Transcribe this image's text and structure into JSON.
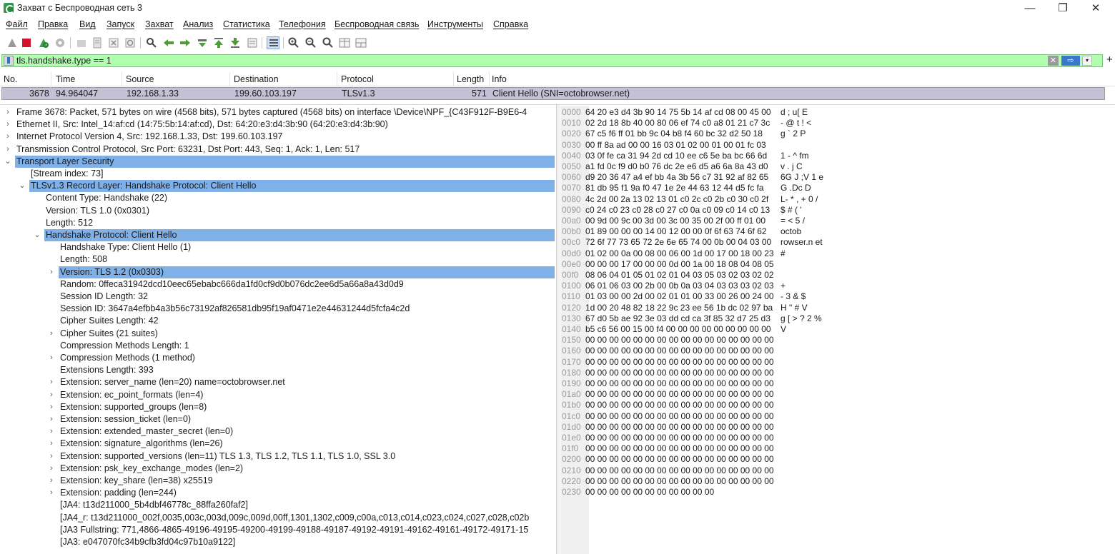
{
  "window": {
    "title": "Захват с Беспроводная сеть 3",
    "minimize": "—",
    "maximize": "❐",
    "close": "✕"
  },
  "menu": [
    "Файл",
    "Правка",
    "Вид",
    "Запуск",
    "Захват",
    "Анализ",
    "Статистика",
    "Телефония",
    "Беспроводная связь",
    "Инструменты",
    "Справка"
  ],
  "toolbar": [
    "shark-fin-start-icon",
    "stop-capture-icon",
    "restart-capture-icon",
    "capture-options-icon",
    "open-file-icon",
    "save-file-icon",
    "close-file-icon",
    "reload-file-icon",
    "find-packet-icon",
    "go-back-icon",
    "go-forward-icon",
    "go-to-packet-icon",
    "go-first-icon",
    "go-last-icon",
    "autoscroll-icon",
    "colorize-icon",
    "zoom-in-icon",
    "zoom-out-icon",
    "zoom-reset-icon",
    "resize-columns-icon",
    "layout-icon"
  ],
  "filter": {
    "value": "tls.handshake.type == 1",
    "clear": "✕",
    "apply": "⇨",
    "dropdown": "▾",
    "add": "+"
  },
  "packet_list": {
    "headers": [
      "No.",
      "Time",
      "Source",
      "Destination",
      "Protocol",
      "Length",
      "Info"
    ],
    "rows": [
      {
        "no": "3678",
        "time": "94.964047",
        "source": "192.168.1.33",
        "destination": "199.60.103.197",
        "protocol": "TLSv1.3",
        "length": "571",
        "info": "Client Hello (SNI=octobrowser.net)"
      }
    ]
  },
  "tree": [
    {
      "text": "Frame 3678: Packet, 571 bytes on wire (4568 bits), 571 bytes captured (4568 bits) on interface \\Device\\NPF_{C43F912F-B9E6-4",
      "level": 0,
      "exp": "›"
    },
    {
      "text": "Ethernet II, Src: Intel_14:af:cd (14:75:5b:14:af:cd), Dst: 64:20:e3:d4:3b:90 (64:20:e3:d4:3b:90)",
      "level": 0,
      "exp": "›"
    },
    {
      "text": "Internet Protocol Version 4, Src: 192.168.1.33, Dst: 199.60.103.197",
      "level": 0,
      "exp": "›"
    },
    {
      "text": "Transmission Control Protocol, Src Port: 63231, Dst Port: 443, Seq: 1, Ack: 1, Len: 517",
      "level": 0,
      "exp": "›"
    },
    {
      "text": "Transport Layer Security",
      "level": 0,
      "exp": "⌄",
      "sel": true
    },
    {
      "text": "[Stream index: 73]",
      "level": 1,
      "exp": ""
    },
    {
      "text": "TLSv1.3 Record Layer: Handshake Protocol: Client Hello",
      "level": 1,
      "exp": "⌄",
      "sel": true
    },
    {
      "text": "Content Type: Handshake (22)",
      "level": 2,
      "exp": ""
    },
    {
      "text": "Version: TLS 1.0 (0x0301)",
      "level": 2,
      "exp": ""
    },
    {
      "text": "Length: 512",
      "level": 2,
      "exp": ""
    },
    {
      "text": "Handshake Protocol: Client Hello",
      "level": 2,
      "exp": "⌄",
      "sel": true
    },
    {
      "text": "Handshake Type: Client Hello (1)",
      "level": 3,
      "exp": ""
    },
    {
      "text": "Length: 508",
      "level": 3,
      "exp": ""
    },
    {
      "text": "Version: TLS 1.2 (0x0303)",
      "level": 3,
      "exp": "›",
      "sel": true
    },
    {
      "text": "Random: 0ffeca31942dcd10eec65ebabc666da1fd0cf9d0b076dc2ee6d5a66a8a43d0d9",
      "level": 3,
      "exp": ""
    },
    {
      "text": "Session ID Length: 32",
      "level": 3,
      "exp": ""
    },
    {
      "text": "Session ID: 3647a4efbb4a3b56c73192af826581db95f19af0471e2e44631244d5fcfa4c2d",
      "level": 3,
      "exp": ""
    },
    {
      "text": "Cipher Suites Length: 42",
      "level": 3,
      "exp": ""
    },
    {
      "text": "Cipher Suites (21 suites)",
      "level": 3,
      "exp": "›"
    },
    {
      "text": "Compression Methods Length: 1",
      "level": 3,
      "exp": ""
    },
    {
      "text": "Compression Methods (1 method)",
      "level": 3,
      "exp": "›"
    },
    {
      "text": "Extensions Length: 393",
      "level": 3,
      "exp": ""
    },
    {
      "text": "Extension: server_name (len=20) name=octobrowser.net",
      "level": 3,
      "exp": "›"
    },
    {
      "text": "Extension: ec_point_formats (len=4)",
      "level": 3,
      "exp": "›"
    },
    {
      "text": "Extension: supported_groups (len=8)",
      "level": 3,
      "exp": "›"
    },
    {
      "text": "Extension: session_ticket (len=0)",
      "level": 3,
      "exp": "›"
    },
    {
      "text": "Extension: extended_master_secret (len=0)",
      "level": 3,
      "exp": "›"
    },
    {
      "text": "Extension: signature_algorithms (len=26)",
      "level": 3,
      "exp": "›"
    },
    {
      "text": "Extension: supported_versions (len=11) TLS 1.3, TLS 1.2, TLS 1.1, TLS 1.0, SSL 3.0",
      "level": 3,
      "exp": "›"
    },
    {
      "text": "Extension: psk_key_exchange_modes (len=2)",
      "level": 3,
      "exp": "›"
    },
    {
      "text": "Extension: key_share (len=38) x25519",
      "level": 3,
      "exp": "›"
    },
    {
      "text": "Extension: padding (len=244)",
      "level": 3,
      "exp": "›"
    },
    {
      "text": "[JA4: t13d211000_5b4dbf46778c_88ffa260faf2]",
      "level": 3,
      "exp": ""
    },
    {
      "text": "[JA4_r: t13d211000_002f,0035,003c,003d,009c,009d,00ff,1301,1302,c009,c00a,c013,c014,c023,c024,c027,c028,c02b",
      "level": 3,
      "exp": ""
    },
    {
      "text": "[JA3 Fullstring: 771,4866-4865-49196-49195-49200-49199-49188-49187-49192-49191-49162-49161-49172-49171-15",
      "level": 3,
      "exp": ""
    },
    {
      "text": "[JA3: e047070fc34b9cfb3fd04c97b10a9122]",
      "level": 3,
      "exp": ""
    }
  ],
  "hex": [
    {
      "off": "0000",
      "bytes": "64 20 e3 d4 3b 90 14 75  5b 14 af cd 08 00 45 00",
      "ascii": "d  ;  u[     E"
    },
    {
      "off": "0010",
      "bytes": "02 2d 18 8b 40 00 80 06  ef 74 c0 a8 01 21 c7 3c",
      "ascii": " -  @    t   !  <"
    },
    {
      "off": "0020",
      "bytes": "67 c5 f6 ff 01 bb 9c 04  b8 f4 60 bc 32 d2 50 18",
      "ascii": "g          ` 2 P"
    },
    {
      "off": "0030",
      "bytes": "00 ff 8a ad 00 00 16 03  01 02 00 01 00 01 fc 03",
      "ascii": ""
    },
    {
      "off": "0040",
      "bytes": "03 0f fe ca 31 94 2d cd  10 ee c6 5e ba bc 66 6d",
      "ascii": "    1 -    ^  fm"
    },
    {
      "off": "0050",
      "bytes": "a1 fd 0c f9 d0 b0 76 dc  2e e6 d5 a6 6a 8a 43 d0",
      "ascii": "      v .   j C"
    },
    {
      "off": "0060",
      "bytes": "d9 20 36 47 a4 ef bb 4a  3b 56 c7 31 92 af 82 65",
      "ascii": "  6G   J ;V 1   e"
    },
    {
      "off": "0070",
      "bytes": "81 db 95 f1 9a f0 47 1e  2e 44 63 12 44 d5 fc fa",
      "ascii": "      G  .Dc D"
    },
    {
      "off": "0080",
      "bytes": "4c 2d 00 2a 13 02 13 01  c0 2c c0 2b c0 30 c0 2f",
      "ascii": "L- *     , + 0 /"
    },
    {
      "off": "0090",
      "bytes": "c0 24 c0 23 c0 28 c0 27  c0 0a c0 09 c0 14 c0 13",
      "ascii": " $ # ( '"
    },
    {
      "off": "00a0",
      "bytes": "00 9d 00 9c 00 3d 00 3c  00 35 00 2f 00 ff 01 00",
      "ascii": "     = <  5 /"
    },
    {
      "off": "00b0",
      "bytes": "01 89 00 00 00 14 00 12  00 00 0f 6f 63 74 6f 62",
      "ascii": "           octob"
    },
    {
      "off": "00c0",
      "bytes": "72 6f 77 73 65 72 2e 6e  65 74 00 0b 00 04 03 00",
      "ascii": "rowser.n et"
    },
    {
      "off": "00d0",
      "bytes": "01 02 00 0a 00 08 00 06  00 1d 00 17 00 18 00 23",
      "ascii": "               #"
    },
    {
      "off": "00e0",
      "bytes": "00 00 00 17 00 00 00 0d  00 1a 00 18 08 04 08 05",
      "ascii": ""
    },
    {
      "off": "00f0",
      "bytes": "08 06 04 01 05 01 02 01  04 03 05 03 02 03 02 02",
      "ascii": ""
    },
    {
      "off": "0100",
      "bytes": "06 01 06 03 00 2b 00 0b  0a 03 04 03 03 03 02 03",
      "ascii": "     +"
    },
    {
      "off": "0110",
      "bytes": "01 03 00 00 2d 00 02 01  01 00 33 00 26 00 24 00",
      "ascii": "    -     3 & $"
    },
    {
      "off": "0120",
      "bytes": "1d 00 20 48 82 18 22 9c  23 ee 56 1b dc 02 97 ba",
      "ascii": "   H  \"  # V"
    },
    {
      "off": "0130",
      "bytes": "67 d0 5b ae 92 3e 03 dd  cd ca 3f 85 32 d7 25 d3",
      "ascii": "g [  >    ? 2 %"
    },
    {
      "off": "0140",
      "bytes": "b5 c6 56 00 15 00 f4 00  00 00 00 00 00 00 00 00",
      "ascii": "  V"
    },
    {
      "off": "0150",
      "bytes": "00 00 00 00 00 00 00 00  00 00 00 00 00 00 00 00",
      "ascii": ""
    },
    {
      "off": "0160",
      "bytes": "00 00 00 00 00 00 00 00  00 00 00 00 00 00 00 00",
      "ascii": ""
    },
    {
      "off": "0170",
      "bytes": "00 00 00 00 00 00 00 00  00 00 00 00 00 00 00 00",
      "ascii": ""
    },
    {
      "off": "0180",
      "bytes": "00 00 00 00 00 00 00 00  00 00 00 00 00 00 00 00",
      "ascii": ""
    },
    {
      "off": "0190",
      "bytes": "00 00 00 00 00 00 00 00  00 00 00 00 00 00 00 00",
      "ascii": ""
    },
    {
      "off": "01a0",
      "bytes": "00 00 00 00 00 00 00 00  00 00 00 00 00 00 00 00",
      "ascii": ""
    },
    {
      "off": "01b0",
      "bytes": "00 00 00 00 00 00 00 00  00 00 00 00 00 00 00 00",
      "ascii": ""
    },
    {
      "off": "01c0",
      "bytes": "00 00 00 00 00 00 00 00  00 00 00 00 00 00 00 00",
      "ascii": ""
    },
    {
      "off": "01d0",
      "bytes": "00 00 00 00 00 00 00 00  00 00 00 00 00 00 00 00",
      "ascii": ""
    },
    {
      "off": "01e0",
      "bytes": "00 00 00 00 00 00 00 00  00 00 00 00 00 00 00 00",
      "ascii": ""
    },
    {
      "off": "01f0",
      "bytes": "00 00 00 00 00 00 00 00  00 00 00 00 00 00 00 00",
      "ascii": ""
    },
    {
      "off": "0200",
      "bytes": "00 00 00 00 00 00 00 00  00 00 00 00 00 00 00 00",
      "ascii": ""
    },
    {
      "off": "0210",
      "bytes": "00 00 00 00 00 00 00 00  00 00 00 00 00 00 00 00",
      "ascii": ""
    },
    {
      "off": "0220",
      "bytes": "00 00 00 00 00 00 00 00  00 00 00 00 00 00 00 00",
      "ascii": ""
    },
    {
      "off": "0230",
      "bytes": "00 00 00 00 00 00 00 00  00 00 00",
      "ascii": ""
    }
  ],
  "colors": {
    "filter_bg": "#afffaf",
    "row_selected": "#c2c2d4",
    "tree_selected": "#7fb0e8"
  }
}
